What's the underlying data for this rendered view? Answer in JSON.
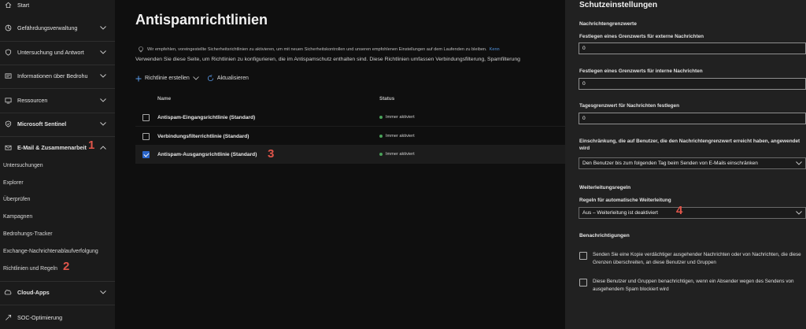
{
  "sidebar": {
    "items": [
      {
        "label": "Start",
        "icon": "home-icon",
        "chevron": false
      },
      {
        "label": "Gefährdungsverwaltung",
        "icon": "threat-management-icon",
        "chevron": true
      },
      {
        "label": "Untersuchung und Antwort",
        "icon": "investigation-icon",
        "chevron": true
      },
      {
        "label": "Informationen über Bedrohu",
        "icon": "threat-intelligence-icon",
        "chevron": true
      },
      {
        "label": "Ressourcen",
        "icon": "assets-icon",
        "chevron": true
      },
      {
        "label": "Microsoft Sentinel",
        "icon": "sentinel-shield-icon",
        "chevron": true
      },
      {
        "label": "E-Mail & Zusammenarbeit",
        "icon": "mail-icon",
        "chevron": true
      },
      {
        "label": "Cloud-Apps",
        "icon": "cloud-icon",
        "chevron": true
      },
      {
        "label": "SOC-Optimierung",
        "icon": "optimization-icon",
        "chevron": false
      }
    ],
    "sub_items": [
      "Untersuchungen",
      "Explorer",
      "Überprüfen",
      "Kampagnen",
      "Bedrohungs-Tracker",
      "Exchange-Nachrichtenablaufverfolgung",
      "Richtlinien und Regeln"
    ]
  },
  "callouts": [
    "1",
    "2",
    "3",
    "4"
  ],
  "main": {
    "title": "Antispamrichtlinien",
    "banner_text": "Wir empfehlen, voreingestellte Sicherheitsrichtlinien zu aktivieren, um mit neuen Sicherheitskontrollen und unseren empfohlenen Einstellungen auf dem Laufenden zu bleiben.",
    "banner_link": "Kenn",
    "description": "Verwenden Sie diese Seite, um Richtlinien zu konfigurieren, die im Antispamschutz enthalten sind. Diese Richtlinien umfassen Verbindungsfilterung, Spamfilterung",
    "toolbar": {
      "create": "Richtlinie erstellen",
      "refresh": "Aktualisieren"
    },
    "columns": {
      "name": "Name",
      "status": "Status"
    },
    "rows": [
      {
        "name": "Antispam-Eingangsrichtlinie (Standard)",
        "status": "Immer aktiviert",
        "checked": false
      },
      {
        "name": "Verbindungsfilterrichtlinie (Standard)",
        "status": "Immer aktiviert",
        "checked": false
      },
      {
        "name": "Antispam-Ausgangsrichtlinie (Standard)",
        "status": "Immer aktiviert",
        "checked": true
      }
    ]
  },
  "panel": {
    "title": "Schutzeinstellungen",
    "section_limits": "Nachrichtengrenzwerte",
    "external_label": "Festlegen eines Grenzwerts für externe Nachrichten",
    "external_value": "0",
    "internal_label": "Festlegen eines Grenzwerts für interne Nachrichten",
    "internal_value": "0",
    "daily_label": "Tagesgrenzwert für Nachrichten festlegen",
    "daily_value": "0",
    "restriction_label": "Einschränkung, die auf Benutzer, die den Nachrichtengrenzwert erreicht haben, angewendet wird",
    "restriction_value": "Den Benutzer bis zum folgenden Tag beim Senden von E-Mails einschränken",
    "section_forwarding": "Weiterleitungsregeln",
    "forwarding_label": "Regeln für automatische Weiterleitung",
    "forwarding_value": "Aus – Weiterleitung ist deaktiviert",
    "section_notifications": "Benachrichtigungen",
    "notify_copy": "Senden Sie eine Kopie verdächtiger ausgehender Nachrichten oder von Nachrichten, die diese Grenzen überschreiten, an diese Benutzer und Gruppen",
    "notify_blocked": "Diese Benutzer und Gruppen benachrichtigen, wenn ein Absender wegen des Sendens von ausgehendem Spam blockiert wird"
  },
  "colors": {
    "callout": "#e0554a",
    "accent": "#2a64c8",
    "status_ok": "#4aa35a",
    "link": "#4f8fd8"
  }
}
